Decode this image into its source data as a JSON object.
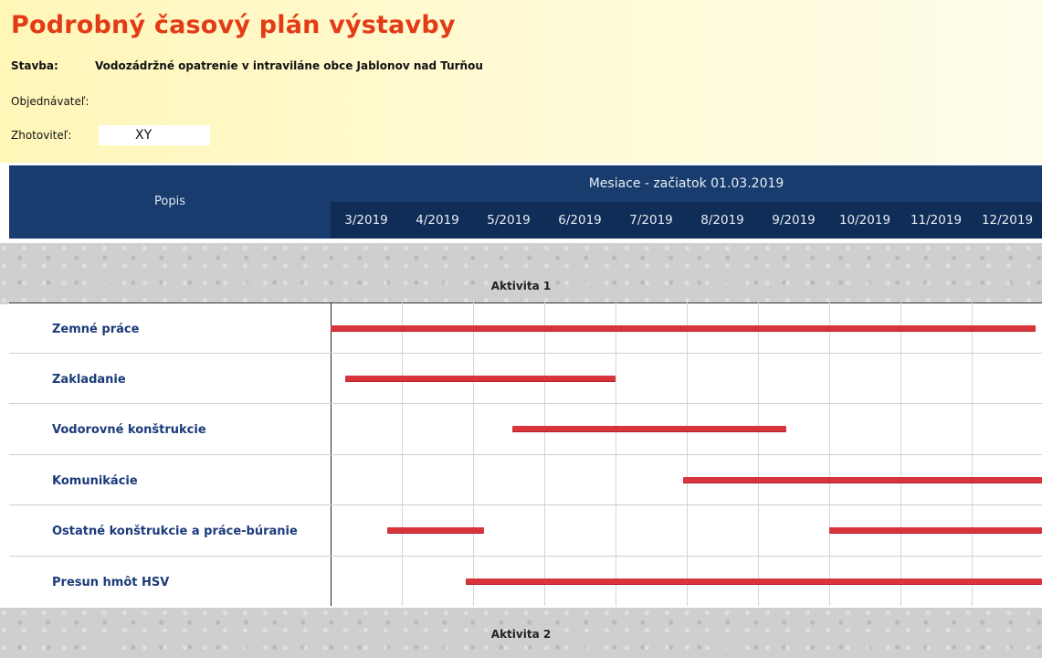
{
  "document": {
    "title": "Podrobný časový plán výstavby",
    "stavba_label": "Stavba:",
    "stavba_value": "Vodozádržné opatrenie v intraviláne obce Jablonov nad Turňou",
    "objednavatel_label": "Objednávateľ:",
    "zhotovitel_label": "Zhotoviteľ:",
    "zhotovitel_value": "XY"
  },
  "table": {
    "popis_header": "Popis",
    "months_header": "Mesiace - začiatok 01.03.2019",
    "months": [
      "3/2019",
      "4/2019",
      "5/2019",
      "6/2019",
      "7/2019",
      "8/2019",
      "9/2019",
      "10/2019",
      "11/2019",
      "12/2019"
    ],
    "activity_1": "Aktivita 1",
    "activity_2": "Aktivita 2",
    "tasks": [
      {
        "name": "Zemné práce",
        "bars": [
          [
            0.0,
            9.9
          ]
        ]
      },
      {
        "name": "Zakladanie",
        "bars": [
          [
            0.2,
            4.0
          ]
        ]
      },
      {
        "name": "Vodorovné konštrukcie",
        "bars": [
          [
            2.55,
            6.4
          ]
        ]
      },
      {
        "name": "Komunikácie",
        "bars": [
          [
            4.95,
            10.0
          ]
        ]
      },
      {
        "name": "Ostatné konštrukcie a práce-búranie",
        "bars": [
          [
            0.8,
            2.15
          ],
          [
            7.0,
            10.0
          ]
        ]
      },
      {
        "name": "Presun hmôt HSV",
        "bars": [
          [
            1.9,
            10.0
          ]
        ]
      }
    ]
  },
  "colors": {
    "title": "#e23b16",
    "header_navy": "#183c6e",
    "bar_red": "#d8343c",
    "task_text": "#1b3a7a"
  }
}
